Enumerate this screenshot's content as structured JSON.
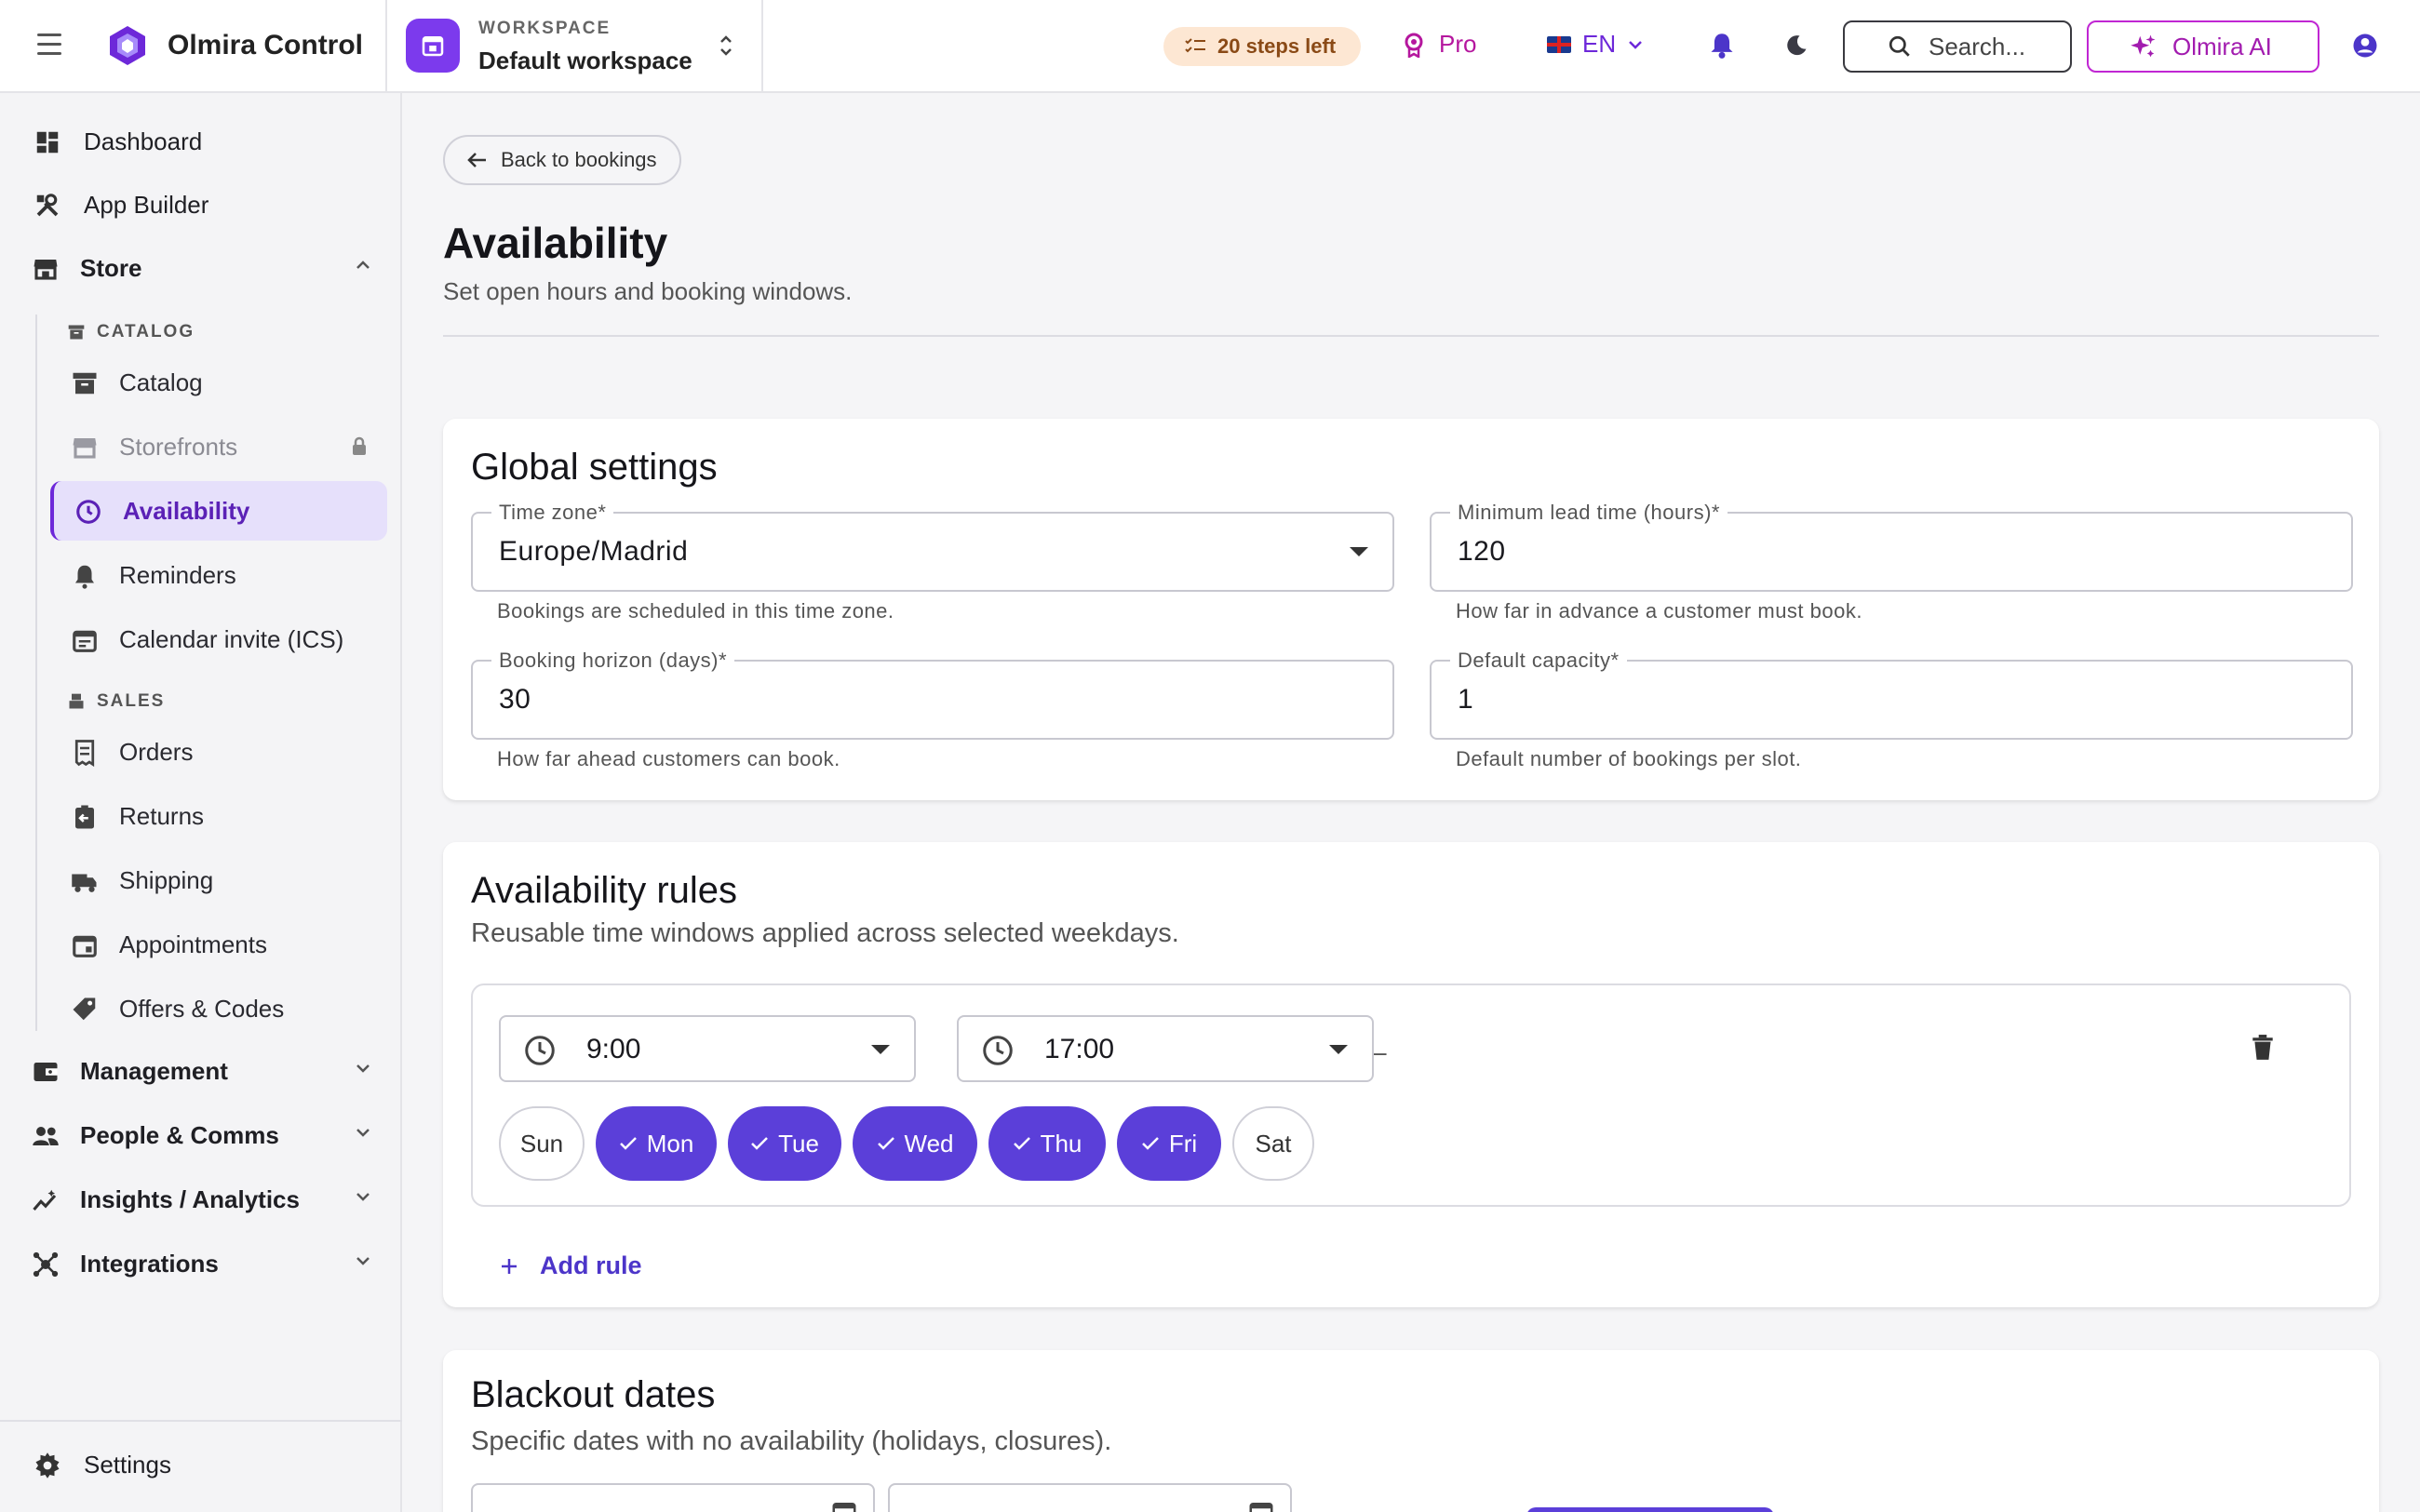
{
  "app": {
    "name": "Olmira Control",
    "workspace_label": "WORKSPACE",
    "workspace_name": "Default workspace"
  },
  "topbar": {
    "steps_left": "20 steps left",
    "plan": "Pro",
    "language": "EN",
    "search_label": "Search...",
    "ai_label": "Olmira AI"
  },
  "sidebar": {
    "top_items": [
      {
        "label": "Dashboard",
        "icon": "dashboard-icon"
      },
      {
        "label": "App Builder",
        "icon": "tools-icon"
      },
      {
        "label": "Store",
        "icon": "store-icon"
      }
    ],
    "catalog_header": "CATALOG",
    "catalog_items": [
      {
        "label": "Catalog"
      },
      {
        "label": "Storefronts"
      },
      {
        "label": "Availability"
      },
      {
        "label": "Reminders"
      },
      {
        "label": "Calendar invite (ICS)"
      }
    ],
    "sales_header": "SALES",
    "sales_items": [
      {
        "label": "Orders"
      },
      {
        "label": "Returns"
      },
      {
        "label": "Shipping"
      },
      {
        "label": "Appointments"
      },
      {
        "label": "Offers & Codes"
      }
    ],
    "groups": [
      {
        "label": "Management"
      },
      {
        "label": "People & Comms"
      },
      {
        "label": "Insights / Analytics"
      },
      {
        "label": "Integrations"
      }
    ],
    "settings": "Settings"
  },
  "page": {
    "back_label": "Back to bookings",
    "title": "Availability",
    "subtitle": "Set open hours and booking windows."
  },
  "global_settings": {
    "title": "Global settings",
    "timezone": {
      "label": "Time zone*",
      "value": "Europe/Madrid",
      "helper": "Bookings are scheduled in this time zone."
    },
    "lead_time": {
      "label": "Minimum lead time (hours)*",
      "value": "120",
      "helper": "How far in advance a customer must book."
    },
    "horizon": {
      "label": "Booking horizon (days)*",
      "value": "30",
      "helper": "How far ahead customers can book."
    },
    "capacity": {
      "label": "Default capacity*",
      "value": "1",
      "helper": "Default number of bookings per slot."
    }
  },
  "availability_rules": {
    "title": "Availability rules",
    "subtitle": "Reusable time windows applied across selected weekdays.",
    "rule": {
      "start": "9:00",
      "separator": "–",
      "end": "17:00",
      "days": [
        {
          "label": "Sun",
          "selected": false
        },
        {
          "label": "Mon",
          "selected": true
        },
        {
          "label": "Tue",
          "selected": true
        },
        {
          "label": "Wed",
          "selected": true
        },
        {
          "label": "Thu",
          "selected": true
        },
        {
          "label": "Fri",
          "selected": true
        },
        {
          "label": "Sat",
          "selected": false
        }
      ]
    },
    "add_rule": "Add rule"
  },
  "blackout": {
    "title": "Blackout dates",
    "subtitle": "Specific dates with no availability (holidays, closures)."
  },
  "colors": {
    "accent": "#5b3fd9",
    "active_bg": "#e6e0fb",
    "ai_border": "#c026d3",
    "steps_bg": "#fde7d3"
  }
}
